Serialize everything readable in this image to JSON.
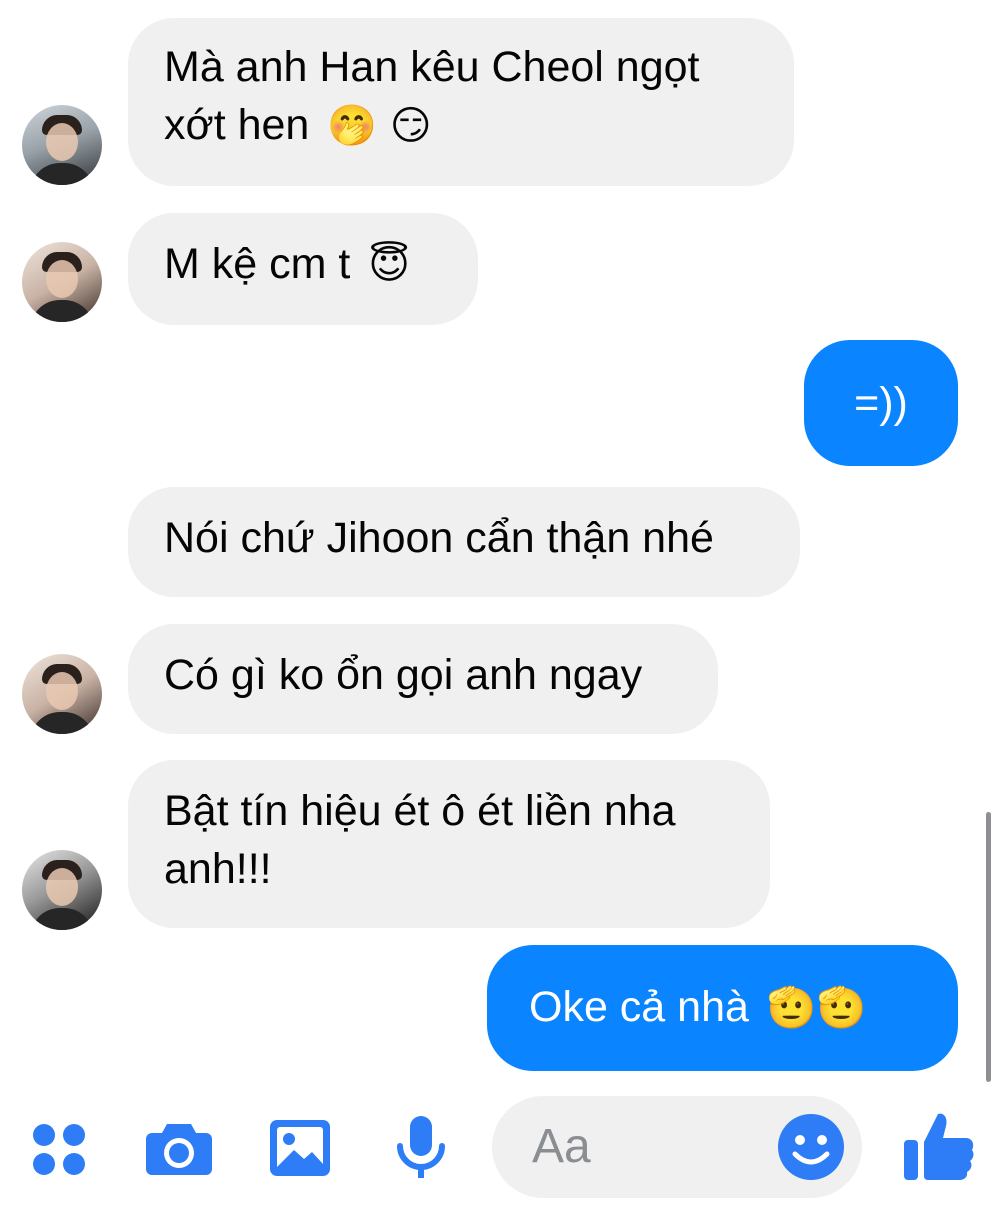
{
  "messages": [
    {
      "text": "Mà anh Han kêu Cheol ngọt xớt hen",
      "emoji": "🤭 😏",
      "mine": false
    },
    {
      "text": "M kệ cm t",
      "emoji": "😇",
      "mine": false
    },
    {
      "text": "=))",
      "emoji": "",
      "mine": true
    },
    {
      "text": "Nói chứ Jihoon cẩn thận nhé",
      "emoji": "",
      "mine": false
    },
    {
      "text": "Có gì ko ổn gọi anh ngay",
      "emoji": "",
      "mine": false
    },
    {
      "text": "Bật tín hiệu ét ô ét liền nha anh!!!",
      "emoji": "",
      "mine": false
    },
    {
      "text": "Oke cả nhà",
      "emoji": "🫡🫡",
      "mine": true
    }
  ],
  "composer": {
    "placeholder": "Aa",
    "icons": [
      "apps-icon",
      "camera-icon",
      "gallery-icon",
      "microphone-icon",
      "emoji-icon",
      "thumbs-up-icon"
    ]
  },
  "colors": {
    "accent": "#0a84ff",
    "incoming_bubble": "#f0f0f0",
    "icon": "#2e7cf6"
  }
}
